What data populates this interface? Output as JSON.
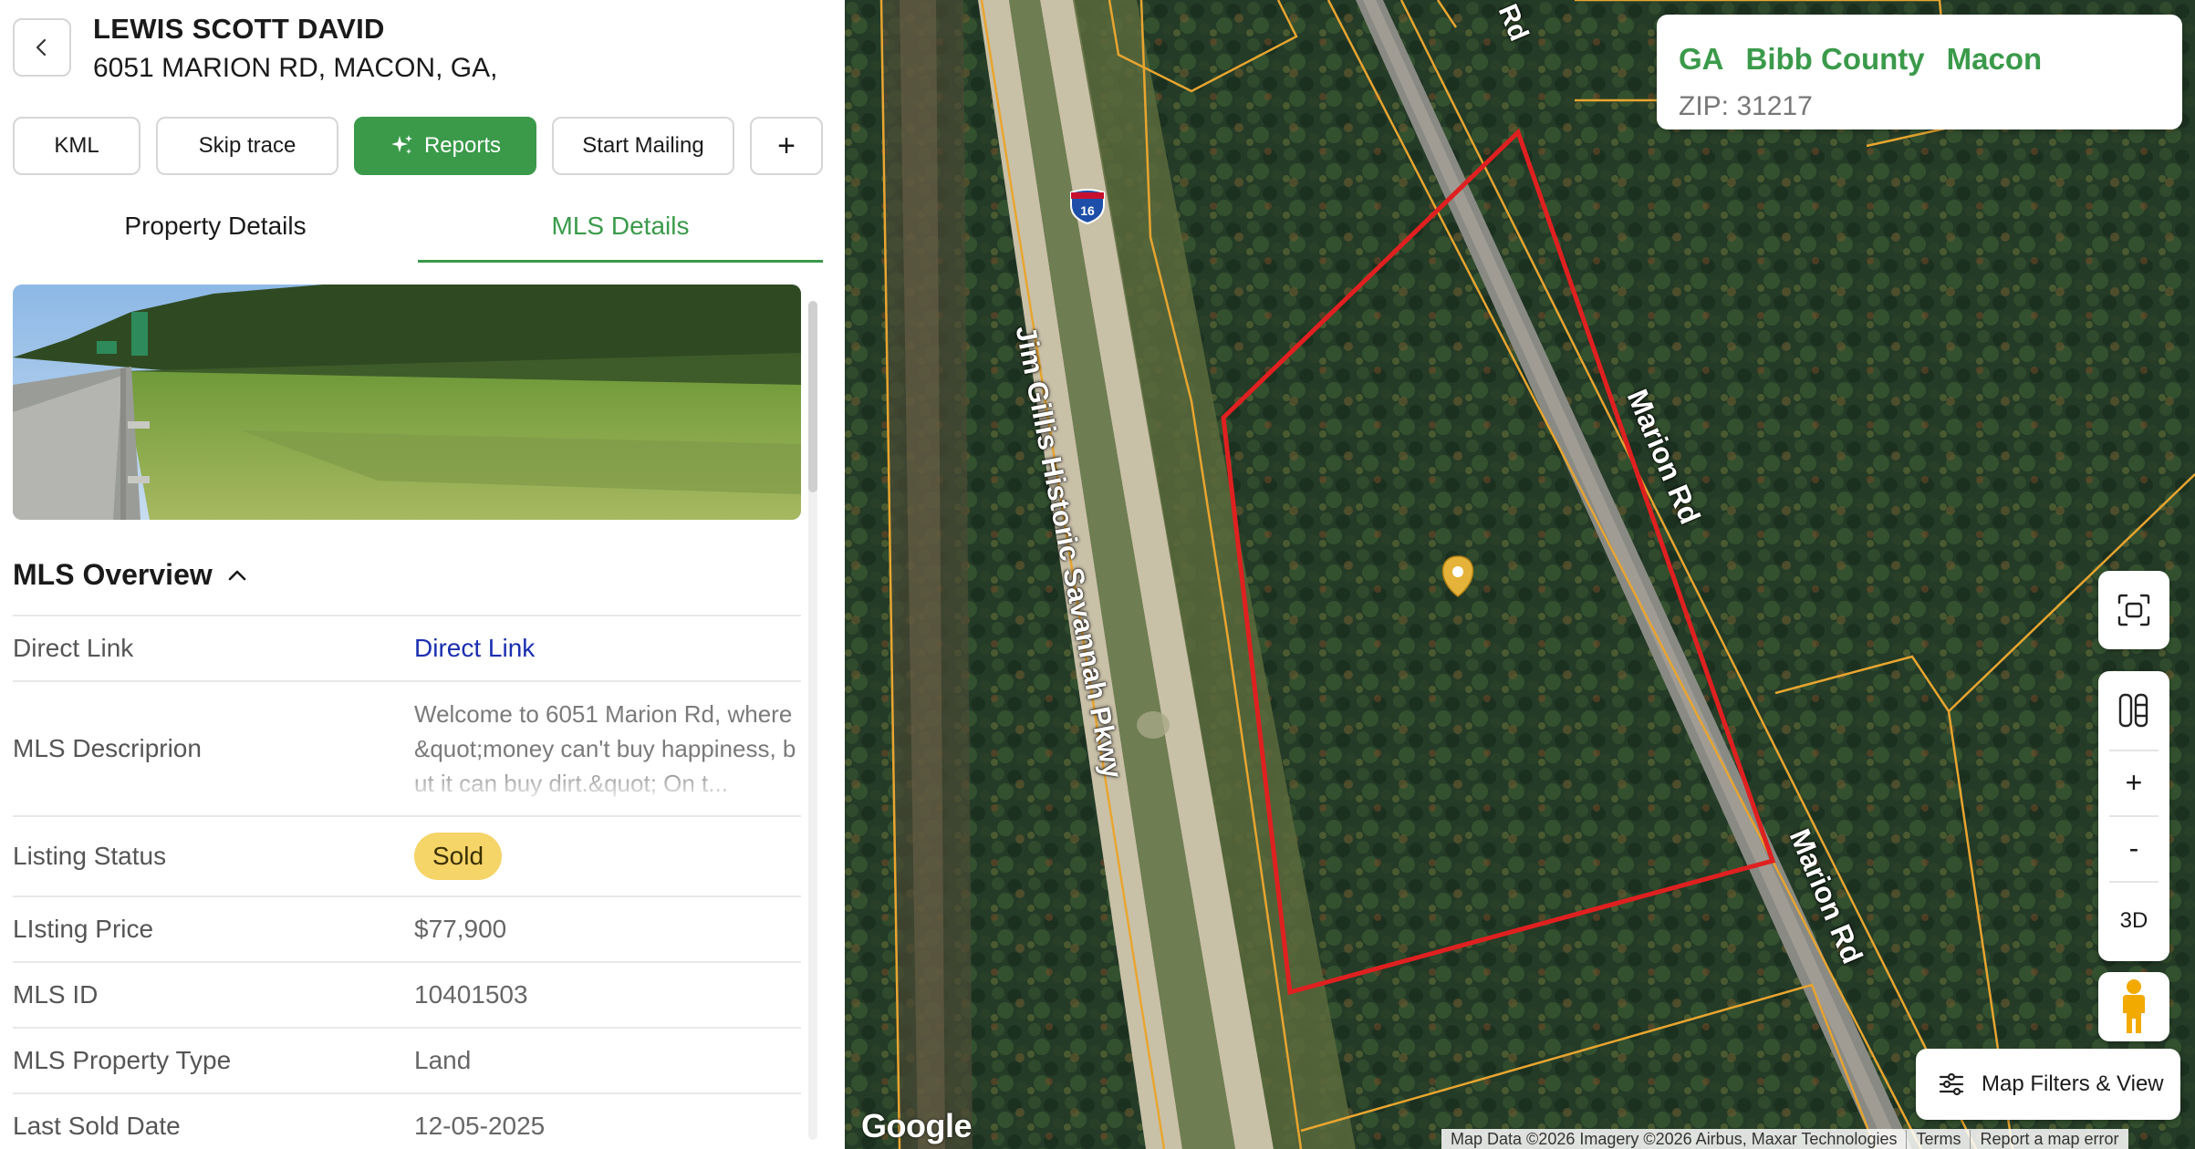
{
  "header": {
    "owner_name": "LEWIS SCOTT DAVID",
    "address": "6051 MARION RD, MACON, GA,"
  },
  "icons": {
    "back": "chevron-left-icon",
    "reports": "sparkle-icon",
    "add": "plus-icon",
    "collapse": "chevron-up-icon",
    "fit": "scan-icon",
    "layers": "layers-icon",
    "pegman": "person-icon",
    "filters": "sliders-icon"
  },
  "actions": {
    "kml": "KML",
    "skip_trace": "Skip trace",
    "reports": "Reports",
    "start_mailing": "Start Mailing",
    "add": "+"
  },
  "tabs": [
    {
      "label": "Property Details",
      "active": false
    },
    {
      "label": "MLS Details",
      "active": true
    }
  ],
  "overview": {
    "title": "MLS Overview",
    "rows": [
      {
        "label": "Direct Link",
        "value": "Direct Link"
      },
      {
        "label": "MLS Descriprion",
        "value": "Welcome to 6051 Marion Rd, where &quot;money can't buy happiness, but it can buy dirt.&quot; On t..."
      },
      {
        "label": "Listing Status",
        "value": "Sold"
      },
      {
        "label": "LIsting Price",
        "value": "$77,900"
      },
      {
        "label": "MLS ID",
        "value": "10401503"
      },
      {
        "label": "MLS Property Type",
        "value": "Land"
      },
      {
        "label": "Last Sold Date",
        "value": "12-05-2025"
      }
    ]
  },
  "map": {
    "location": {
      "state": "GA",
      "county": "Bibb County",
      "city": "Macon",
      "zip": "ZIP: 31217"
    },
    "road_labels": [
      "Rd",
      "Marion Rd",
      "Marion Rd",
      "Jim Gillis Historic Savannah Pkwy"
    ],
    "highway_shield": "16",
    "controls": {
      "zoom_in": "+",
      "zoom_out": "-",
      "three_d": "3D",
      "filters": "Map Filters & View"
    },
    "logo": "Google",
    "attribution": [
      "Map Data ©2026 Imagery ©2026 Airbus, Maxar Technologies",
      "Terms",
      "Report a map error"
    ]
  },
  "colors": {
    "accent_green": "#3a9a4a",
    "link_blue": "#1a2fb0",
    "sold_badge": "#f5d468",
    "parcel_red": "#e02020",
    "parcel_line": "#e8a530"
  }
}
